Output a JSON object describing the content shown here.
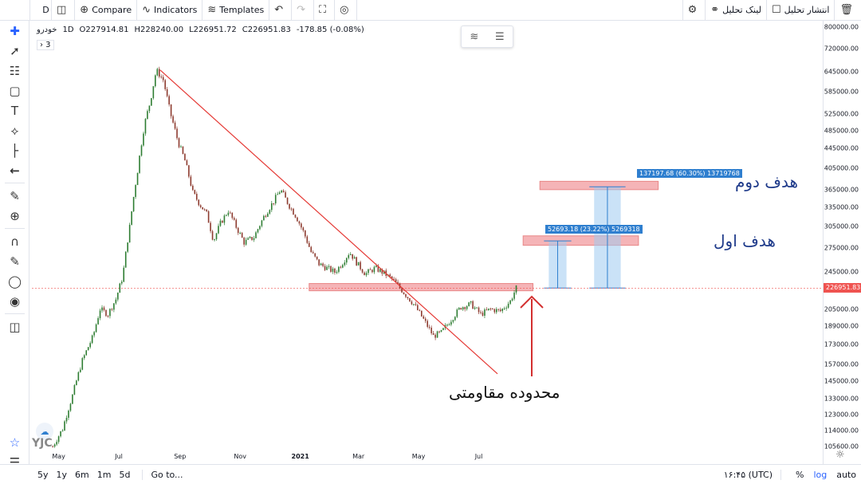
{
  "topbar": {
    "interval": "D",
    "compare_label": "Compare",
    "indicators_label": "Indicators",
    "templates_label": "Templates",
    "publish_label": "انتشار تحلیل",
    "link_label": "لینک تحلیل"
  },
  "legend": {
    "symbol": "خودرو",
    "interval": "1D",
    "open": "O227914.81",
    "high": "H228240.00",
    "low": "L226951.72",
    "close": "C226951.83",
    "change": "-178.85 (-0.08%)",
    "collapse_label": "› 3"
  },
  "price_axis": {
    "labels": [
      "800000.00",
      "720000.00",
      "645000.00",
      "585000.00",
      "525000.00",
      "485000.00",
      "445000.00",
      "405000.00",
      "365000.00",
      "335000.00",
      "305000.00",
      "275000.00",
      "245000.00",
      "205000.00",
      "189000.00",
      "173000.00",
      "157000.00",
      "145000.00",
      "133000.00",
      "123000.00",
      "114000.00",
      "105600.00"
    ],
    "current_price": "226951.83"
  },
  "time_axis": {
    "labels": [
      "May",
      "Jul",
      "Sep",
      "Nov",
      "2021",
      "Mar",
      "May",
      "Jul"
    ]
  },
  "annotations": {
    "target2": "هدف دوم",
    "target1": "هدف اول",
    "resistance": "محدوده مقاومتی",
    "target2_measure": "137197.68 (60.30%) 13719768",
    "target1_measure": "52693.18 (23.22%) 5269318"
  },
  "bottombar": {
    "ranges": [
      "5y",
      "1y",
      "6m",
      "1m",
      "5d"
    ],
    "goto_label": "Go to...",
    "clock": "۱۶:۴۵ (UTC)",
    "percent_label": "%",
    "log_label": "log",
    "auto_label": "auto"
  },
  "watermark": "YJC",
  "colors": {
    "up": "#26a69a",
    "down": "#ef5350",
    "trendline": "#e53935",
    "zone_fill": "#f4a7ab",
    "zone_stroke": "#e57373",
    "measure": "#9ecbf0",
    "accent": "#2962ff"
  },
  "chart_data": {
    "type": "candlestick",
    "symbol": "خودرو",
    "interval": "1D",
    "x_start": "2020-04-20",
    "x_end": "2021-08-10",
    "price_points": [
      [
        "2020-04-25",
        105600
      ],
      [
        "2020-05-05",
        115000
      ],
      [
        "2020-05-15",
        135000
      ],
      [
        "2020-05-25",
        160000
      ],
      [
        "2020-06-05",
        180000
      ],
      [
        "2020-06-12",
        205000
      ],
      [
        "2020-06-20",
        200000
      ],
      [
        "2020-06-28",
        215000
      ],
      [
        "2020-07-05",
        240000
      ],
      [
        "2020-07-12",
        305000
      ],
      [
        "2020-07-20",
        400000
      ],
      [
        "2020-07-27",
        500000
      ],
      [
        "2020-08-02",
        560000
      ],
      [
        "2020-08-08",
        650000
      ],
      [
        "2020-08-15",
        620000
      ],
      [
        "2020-08-22",
        530000
      ],
      [
        "2020-08-30",
        460000
      ],
      [
        "2020-09-06",
        420000
      ],
      [
        "2020-09-14",
        360000
      ],
      [
        "2020-09-21",
        340000
      ],
      [
        "2020-09-28",
        325000
      ],
      [
        "2020-10-05",
        285000
      ],
      [
        "2020-10-12",
        310000
      ],
      [
        "2020-10-20",
        330000
      ],
      [
        "2020-10-28",
        305000
      ],
      [
        "2020-11-05",
        283000
      ],
      [
        "2020-11-15",
        290000
      ],
      [
        "2020-11-25",
        320000
      ],
      [
        "2020-12-05",
        345000
      ],
      [
        "2020-12-12",
        365000
      ],
      [
        "2020-12-20",
        340000
      ],
      [
        "2020-12-28",
        320000
      ],
      [
        "2021-01-05",
        295000
      ],
      [
        "2021-01-12",
        270000
      ],
      [
        "2021-01-20",
        255000
      ],
      [
        "2021-01-28",
        250000
      ],
      [
        "2021-02-05",
        245000
      ],
      [
        "2021-02-12",
        255000
      ],
      [
        "2021-02-20",
        270000
      ],
      [
        "2021-02-28",
        255000
      ],
      [
        "2021-03-08",
        243000
      ],
      [
        "2021-03-18",
        250000
      ],
      [
        "2021-03-28",
        243000
      ],
      [
        "2021-04-06",
        235000
      ],
      [
        "2021-04-16",
        222000
      ],
      [
        "2021-04-26",
        210000
      ],
      [
        "2021-05-06",
        195000
      ],
      [
        "2021-05-16",
        180000
      ],
      [
        "2021-05-24",
        183000
      ],
      [
        "2021-06-03",
        195000
      ],
      [
        "2021-06-13",
        207000
      ],
      [
        "2021-06-23",
        210000
      ],
      [
        "2021-07-03",
        200000
      ],
      [
        "2021-07-13",
        205000
      ],
      [
        "2021-07-23",
        203000
      ],
      [
        "2021-08-02",
        213000
      ],
      [
        "2021-08-08",
        226951.83
      ]
    ],
    "trendline": [
      [
        "2020-08-12",
        650000
      ],
      [
        "2021-07-20",
        150000
      ]
    ],
    "zones": [
      {
        "label": "resistance",
        "price_low": 224000,
        "price_high": 232000,
        "x_from": "2021-01-10",
        "x_to": "2021-08-25"
      },
      {
        "label": "target1",
        "price_low": 279000,
        "price_high": 292000,
        "x_from": "2021-08-15",
        "x_to": "2021-12-10"
      },
      {
        "label": "target2",
        "price_low": 365000,
        "price_high": 380000,
        "x_from": "2021-09-01",
        "x_to": "2021-12-30"
      }
    ],
    "ylim": [
      105600,
      800000
    ],
    "yscale": "log"
  }
}
